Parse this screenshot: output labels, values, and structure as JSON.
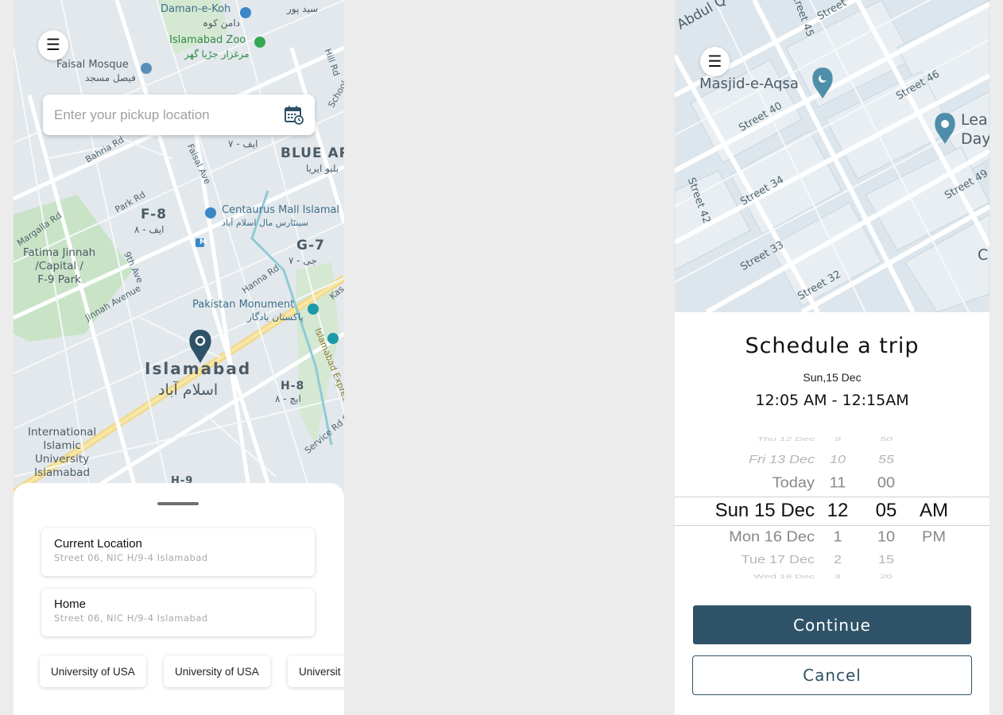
{
  "left_screen": {
    "menu_icon": "hamburger-icon",
    "search": {
      "placeholder": "Enter your pickup location",
      "icon": "calendar-clock-icon"
    },
    "map_labels": {
      "daman_e_koh": "Daman-e-Koh",
      "daman_e_koh_urdu": "دامن کوہ",
      "syed_pur_urdu": "سید پور",
      "islamabad_zoo": "Islamabad Zoo",
      "islamabad_zoo_urdu": "مرغزار جڑیا گھر",
      "faisal_mosque": "Faisal Mosque",
      "faisal_mosque_urdu": "فیصل مسجد",
      "f8": "F-8",
      "f8_urdu": "ایف - ۸",
      "f7_urdu": "ایف - ۷",
      "blue_area": "BLUE AR",
      "blue_area_urdu": "بلیو ایریا",
      "centaurus": "Centaurus Mall Islamal",
      "centaurus_urdu": "سینٹارس مال اسلام آباد",
      "g7": "G-7",
      "g7_urdu": "جی - ۷",
      "fatima_jinnah": "Fatima Jinnah\n/Capital /\nF-9 Park",
      "pakistan_monument": "Pakistan Monument",
      "pakistan_monument_urdu": "پاکستان یادگار",
      "islamabad": "Islamabad",
      "islamabad_urdu": "اسلام آباد",
      "h8": "H-8",
      "h8_urdu": "ایچ - ۸",
      "international": "International\nIslamic\nUniversity\nIslamabad",
      "h9": "H-9",
      "park_rd": "Park Rd",
      "bahria_rd": "Bahria Rd",
      "faisal_ave": "Faisal Ave",
      "margalla_rd": "Margalla Rd",
      "ninth_ave": "9th Ave",
      "jinnah_ave": "Jinnah Avenue",
      "hanna_rd": "Hanna Rd",
      "islamabad_expy": "Islamabad Express",
      "service_rd": "Service Rd S",
      "hill_rd": "Hill Rd",
      "school": "School",
      "kas": "Kas",
      "m_marker": "M"
    },
    "saved_locations": [
      {
        "title": "Current Location",
        "subtitle": "Street 06, NIC H/9-4 Islamabad"
      },
      {
        "title": "Home",
        "subtitle": "Street 06, NIC H/9-4 Islamabad"
      }
    ],
    "chips": [
      "University of USA",
      "University of USA",
      "Universit"
    ]
  },
  "right_screen": {
    "menu_icon": "hamburger-icon",
    "map_labels": {
      "abdul": "Abdul Q",
      "masjid": "Masjid-e-Aqsa",
      "street40": "Street 40",
      "street46": "Street 46",
      "street45": "Street 45",
      "street_top": "Street",
      "lea": "Lea",
      "day": "Day",
      "street34": "Street 34",
      "street49": "Street 49",
      "street42": "Street 42",
      "street33": "Street 33",
      "street32": "Street 32",
      "c": "C"
    },
    "title": "Schedule a trip",
    "date": "Sun,15 Dec",
    "range": "12:05 AM - 12:15AM",
    "picker": {
      "rows": [
        {
          "day": "Thu 12 Dec",
          "hour": "9",
          "min": "50",
          "ampm": ""
        },
        {
          "day": "Fri 13 Dec",
          "hour": "10",
          "min": "55",
          "ampm": ""
        },
        {
          "day": "Today",
          "hour": "11",
          "min": "00",
          "ampm": ""
        },
        {
          "day": "Sun 15 Dec",
          "hour": "12",
          "min": "05",
          "ampm": "AM"
        },
        {
          "day": "Mon 16 Dec",
          "hour": "1",
          "min": "10",
          "ampm": "PM"
        },
        {
          "day": "Tue 17 Dec",
          "hour": "2",
          "min": "15",
          "ampm": ""
        },
        {
          "day": "Wed 18 Dec",
          "hour": "3",
          "min": "20",
          "ampm": ""
        }
      ],
      "selected_index": 3
    },
    "continue_label": "Continue",
    "cancel_label": "Cancel"
  }
}
